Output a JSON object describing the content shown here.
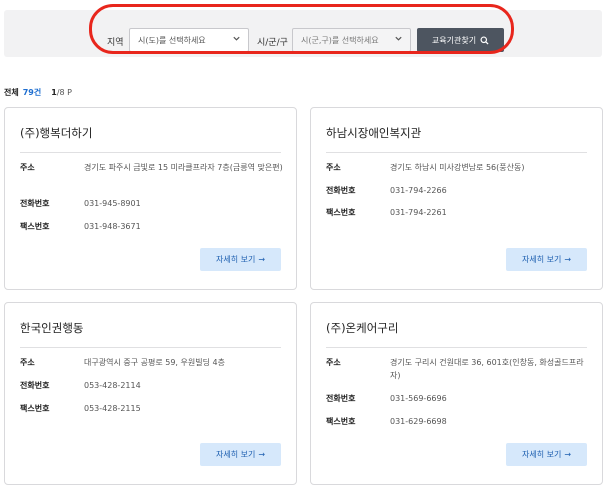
{
  "filter": {
    "region_label": "지역",
    "region_placeholder": "시(도)를 선택하세요",
    "district_label": "시/군/구",
    "district_placeholder": "시(군,구)를 선택하세요",
    "search_label": "교육기관찾기"
  },
  "summary": {
    "total_label": "전체",
    "total_count": "79건",
    "page_current": "1",
    "page_rest": "/8 P"
  },
  "labels": {
    "address": "주소",
    "phone": "전화번호",
    "fax": "팩스번호",
    "detail": "자세히 보기"
  },
  "cards": [
    {
      "name": "(주)행복더하기",
      "address": "경기도 파주시 금빛로 15 미라클프라자 7층(금릉역 맞은편)",
      "phone": "031-945-8901",
      "fax": "031-948-3671"
    },
    {
      "name": "하남시장애인복지관",
      "address": "경기도 하남시 미사강변남로 56(풍산동)",
      "phone": "031-794-2266",
      "fax": "031-794-2261"
    },
    {
      "name": "한국인권행동",
      "address": "대구광역시 중구 공평로 59, 우원빌딩 4층",
      "phone": "053-428-2114",
      "fax": "053-428-2115"
    },
    {
      "name": "(주)온케어구리",
      "address": "경기도 구리시 건원대로 36, 601호(인창동, 화성골드프라자)",
      "phone": "031-569-6696",
      "fax": "031-629-6698"
    }
  ],
  "colors": {
    "accent": "#1e6ed0",
    "highlight": "#e8261c",
    "button_dark": "#4d5560",
    "detail_bg": "#d6e8fb"
  },
  "icons": {
    "search": "search-icon",
    "chevron": "chevron-down-icon",
    "arrow": "arrow-right-icon"
  }
}
